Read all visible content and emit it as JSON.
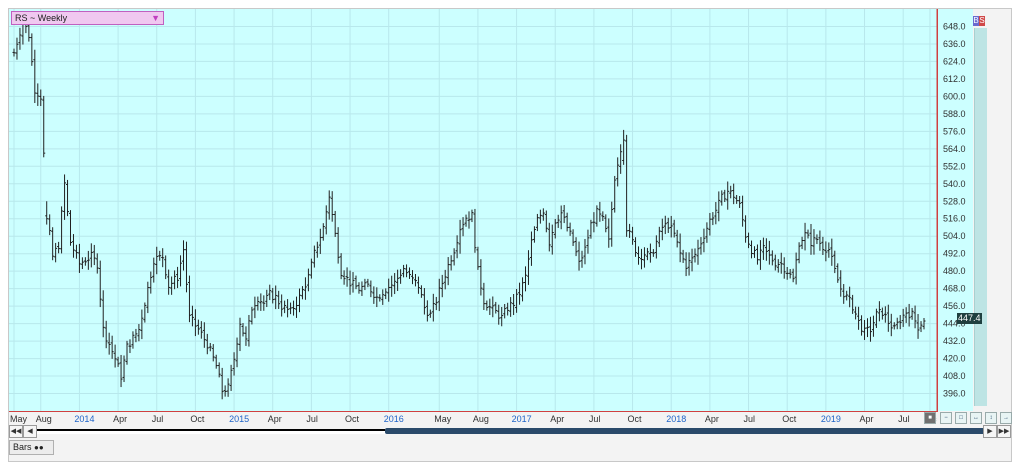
{
  "window": {
    "chart_title": "RS ~ Weekly",
    "bottom_tab_label": "Bars",
    "side_buttons": [
      "B",
      "S"
    ],
    "last_price": "447.4"
  },
  "colors": {
    "background": "#ccffff",
    "grid": "#b8e8ec",
    "bar": "#202020",
    "year_label": "#1e64c8",
    "month_label": "#303030",
    "border": "#d04040",
    "title_box": "#f0c8f0"
  },
  "chart_data": {
    "type": "bar",
    "style": "OHLC price bars (weekly)",
    "title": "RS ~ Weekly",
    "ylim": [
      384,
      660
    ],
    "yticks": [
      "648.0",
      "636.0",
      "624.0",
      "612.0",
      "600.0",
      "588.0",
      "576.0",
      "564.0",
      "552.0",
      "540.0",
      "528.0",
      "516.0",
      "504.0",
      "492.0",
      "480.0",
      "468.0",
      "456.0",
      "444.0",
      "432.0",
      "420.0",
      "408.0",
      "396.0"
    ],
    "ytick_values": [
      648,
      636,
      624,
      612,
      600,
      588,
      576,
      564,
      552,
      540,
      528,
      516,
      504,
      492,
      480,
      468,
      456,
      444,
      432,
      420,
      408,
      396
    ],
    "x_labels": [
      {
        "text": "May",
        "year": false
      },
      {
        "text": "Aug",
        "year": false
      },
      {
        "text": "2014",
        "year": true
      },
      {
        "text": "Apr",
        "year": false
      },
      {
        "text": "Jul",
        "year": false
      },
      {
        "text": "Oct",
        "year": false
      },
      {
        "text": "2015",
        "year": true
      },
      {
        "text": "Apr",
        "year": false
      },
      {
        "text": "Jul",
        "year": false
      },
      {
        "text": "Oct",
        "year": false
      },
      {
        "text": "2016",
        "year": true
      },
      {
        "text": "May",
        "year": false
      },
      {
        "text": "Aug",
        "year": false
      },
      {
        "text": "2017",
        "year": true
      },
      {
        "text": "Apr",
        "year": false
      },
      {
        "text": "Jul",
        "year": false
      },
      {
        "text": "Oct",
        "year": false
      },
      {
        "text": "2018",
        "year": true
      },
      {
        "text": "Apr",
        "year": false
      },
      {
        "text": "Jul",
        "year": false
      },
      {
        "text": "Oct",
        "year": false
      },
      {
        "text": "2019",
        "year": true
      },
      {
        "text": "Apr",
        "year": false
      },
      {
        "text": "Jul",
        "year": false
      },
      {
        "text": "Oc",
        "year": false
      }
    ],
    "x_label_weeks": [
      0,
      9,
      22,
      35,
      48,
      61,
      74,
      87,
      100,
      113,
      126,
      143,
      156,
      169,
      182,
      195,
      208,
      221,
      234,
      247,
      260,
      273,
      286,
      299,
      308
    ],
    "key_prices": [
      [
        0,
        630
      ],
      [
        3,
        652
      ],
      [
        5,
        642
      ],
      [
        7,
        605
      ],
      [
        9,
        600
      ],
      [
        11,
        520
      ],
      [
        13,
        490
      ],
      [
        15,
        498
      ],
      [
        17,
        540
      ],
      [
        19,
        500
      ],
      [
        22,
        485
      ],
      [
        24,
        488
      ],
      [
        26,
        490
      ],
      [
        28,
        485
      ],
      [
        30,
        440
      ],
      [
        32,
        430
      ],
      [
        34,
        420
      ],
      [
        36,
        408
      ],
      [
        38,
        428
      ],
      [
        42,
        440
      ],
      [
        45,
        468
      ],
      [
        47,
        488
      ],
      [
        50,
        490
      ],
      [
        52,
        470
      ],
      [
        55,
        476
      ],
      [
        57,
        495
      ],
      [
        59,
        448
      ],
      [
        62,
        440
      ],
      [
        65,
        430
      ],
      [
        68,
        415
      ],
      [
        70,
        398
      ],
      [
        72,
        400
      ],
      [
        74,
        420
      ],
      [
        76,
        445
      ],
      [
        78,
        432
      ],
      [
        80,
        455
      ],
      [
        82,
        462
      ],
      [
        84,
        458
      ],
      [
        86,
        464
      ],
      [
        88,
        462
      ],
      [
        90,
        456
      ],
      [
        93,
        452
      ],
      [
        96,
        462
      ],
      [
        99,
        476
      ],
      [
        101,
        492
      ],
      [
        104,
        510
      ],
      [
        106,
        532
      ],
      [
        108,
        505
      ],
      [
        110,
        480
      ],
      [
        113,
        472
      ],
      [
        116,
        468
      ],
      [
        119,
        470
      ],
      [
        122,
        462
      ],
      [
        125,
        468
      ],
      [
        128,
        472
      ],
      [
        131,
        482
      ],
      [
        133,
        476
      ],
      [
        136,
        470
      ],
      [
        138,
        455
      ],
      [
        140,
        450
      ],
      [
        142,
        460
      ],
      [
        144,
        472
      ],
      [
        146,
        484
      ],
      [
        148,
        495
      ],
      [
        150,
        510
      ],
      [
        152,
        517
      ],
      [
        154,
        518
      ],
      [
        156,
        480
      ],
      [
        158,
        460
      ],
      [
        160,
        455
      ],
      [
        162,
        452
      ],
      [
        164,
        448
      ],
      [
        166,
        455
      ],
      [
        168,
        458
      ],
      [
        170,
        465
      ],
      [
        172,
        476
      ],
      [
        174,
        500
      ],
      [
        176,
        515
      ],
      [
        178,
        522
      ],
      [
        180,
        500
      ],
      [
        182,
        515
      ],
      [
        184,
        520
      ],
      [
        186,
        510
      ],
      [
        188,
        500
      ],
      [
        190,
        485
      ],
      [
        192,
        495
      ],
      [
        194,
        512
      ],
      [
        196,
        520
      ],
      [
        198,
        515
      ],
      [
        200,
        500
      ],
      [
        202,
        545
      ],
      [
        204,
        565
      ],
      [
        206,
        510
      ],
      [
        208,
        500
      ],
      [
        210,
        490
      ],
      [
        212,
        492
      ],
      [
        214,
        490
      ],
      [
        216,
        500
      ],
      [
        218,
        510
      ],
      [
        220,
        512
      ],
      [
        222,
        505
      ],
      [
        224,
        492
      ],
      [
        226,
        484
      ],
      [
        228,
        488
      ],
      [
        230,
        495
      ],
      [
        232,
        505
      ],
      [
        234,
        515
      ],
      [
        236,
        522
      ],
      [
        238,
        530
      ],
      [
        240,
        535
      ],
      [
        242,
        532
      ],
      [
        244,
        525
      ],
      [
        246,
        505
      ],
      [
        248,
        495
      ],
      [
        250,
        488
      ],
      [
        252,
        495
      ],
      [
        254,
        490
      ],
      [
        256,
        486
      ],
      [
        258,
        485
      ],
      [
        260,
        480
      ],
      [
        262,
        474
      ],
      [
        264,
        500
      ],
      [
        266,
        505
      ],
      [
        268,
        500
      ],
      [
        270,
        502
      ],
      [
        272,
        497
      ],
      [
        274,
        495
      ],
      [
        276,
        480
      ],
      [
        278,
        468
      ],
      [
        280,
        462
      ],
      [
        282,
        456
      ],
      [
        284,
        445
      ],
      [
        286,
        438
      ],
      [
        288,
        440
      ],
      [
        290,
        450
      ],
      [
        292,
        452
      ],
      [
        294,
        445
      ],
      [
        296,
        440
      ],
      [
        298,
        447
      ],
      [
        300,
        452
      ],
      [
        302,
        450
      ],
      [
        304,
        442
      ],
      [
        306,
        447
      ]
    ],
    "special_bars": [
      {
        "week": 11,
        "open": 518,
        "high": 528,
        "low": 512,
        "close": 516
      },
      {
        "week": 205,
        "open": 556,
        "high": 577,
        "low": 553,
        "close": 570
      }
    ]
  }
}
